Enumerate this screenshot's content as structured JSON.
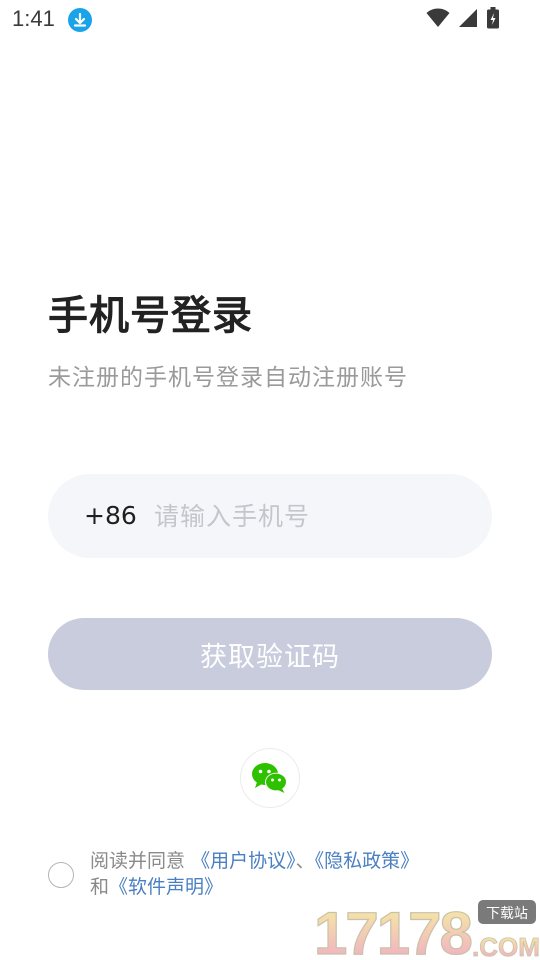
{
  "status_bar": {
    "time": "1:41",
    "icons": [
      "download-icon",
      "wifi-icon",
      "signal-icon",
      "battery-icon"
    ]
  },
  "login": {
    "title": "手机号登录",
    "subtitle": "未注册的手机号登录自动注册账号",
    "country_code": "+86",
    "phone_placeholder": "请输入手机号",
    "phone_value": "",
    "get_code_label": "获取验证码"
  },
  "social": {
    "wechat_icon": "wechat-icon"
  },
  "agreement": {
    "checked": false,
    "prefix": "阅读并同意",
    "user_agreement": "《用户协议》",
    "separator": "、",
    "privacy_policy": "《隐私政策》",
    "and": "和",
    "software_statement": "《软件声明》"
  },
  "watermark": {
    "text": "17178",
    "badge": "下载站",
    "suffix": ".COM"
  },
  "colors": {
    "accent_link": "#4a7fc1",
    "button_disabled": "#c8ccdd",
    "input_bg": "#f5f6f9",
    "wechat_green": "#2dc100",
    "download_badge": "#1aa3e8"
  }
}
